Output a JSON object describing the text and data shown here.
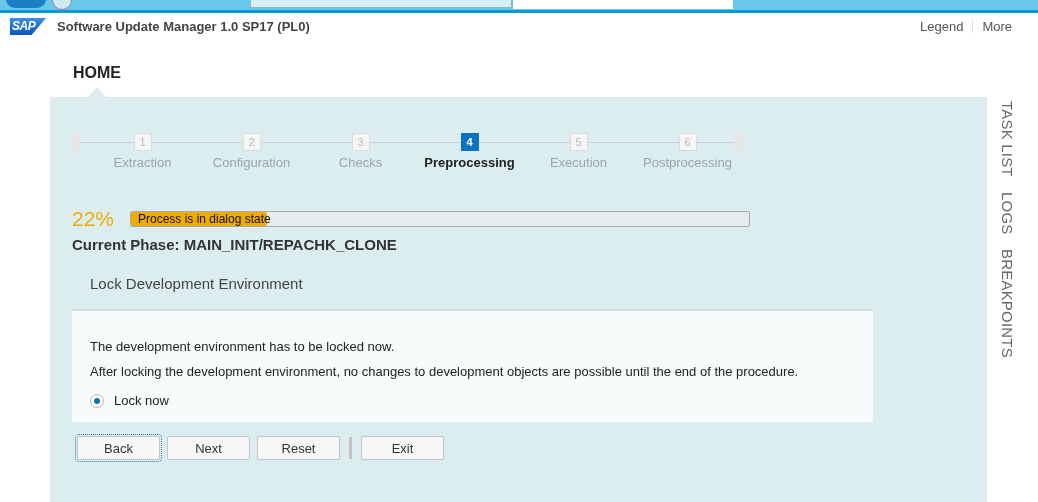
{
  "header": {
    "logo": "SAP",
    "title": "Software Update Manager 1.0 SP17 (PL0)",
    "links": [
      "Legend",
      "More"
    ]
  },
  "nav": {
    "label": "HOME"
  },
  "steps": [
    {
      "number": "1",
      "label": "Extraction",
      "selected": false
    },
    {
      "number": "2",
      "label": "Configuration",
      "selected": false
    },
    {
      "number": "3",
      "label": "Checks",
      "selected": false
    },
    {
      "number": "4",
      "label": "Preprocessing",
      "selected": true
    },
    {
      "number": "5",
      "label": "Execution",
      "selected": false
    },
    {
      "number": "6",
      "label": "Postprocessing",
      "selected": false
    }
  ],
  "progress": {
    "percent": "22%",
    "level": 0.22,
    "message": "Process is in dialog state"
  },
  "current_phase": "Current Phase: MAIN_INIT/REPACHK_CLONE",
  "dialog": {
    "title": "Lock Development Environment",
    "paragraphs": [
      "The development environment has to be locked now.",
      "After locking the development environment, no changes to development objects are possible until the end of the procedure."
    ],
    "options": [
      {
        "label": "Lock now",
        "selected": true
      }
    ]
  },
  "button_groups": [
    [
      {
        "label": "Back",
        "focused": true
      },
      {
        "label": "Next",
        "focused": false
      },
      {
        "label": "Reset",
        "focused": false
      }
    ],
    [
      {
        "label": "Exit",
        "focused": false
      }
    ]
  ],
  "side_tabs": [
    "TASK LIST",
    "LOGS",
    "BREAKPOINTS"
  ]
}
